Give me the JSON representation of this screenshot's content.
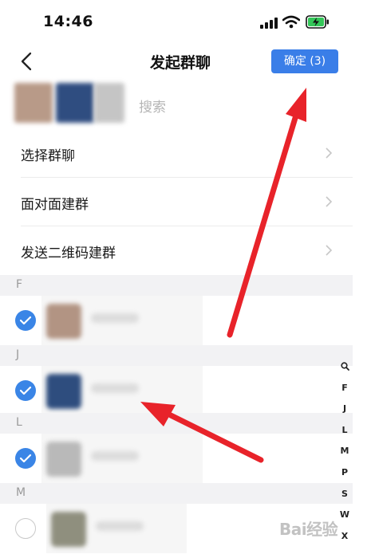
{
  "status_bar": {
    "time": "14:46"
  },
  "nav": {
    "title": "发起群聊",
    "confirm_label": "确定 (3)"
  },
  "search": {
    "placeholder": "搜索"
  },
  "menu": [
    {
      "label": "选择群聊"
    },
    {
      "label": "面对面建群"
    },
    {
      "label": "发送二维码建群"
    }
  ],
  "sections": [
    {
      "letter": "F",
      "contacts": [
        {
          "checked": true
        }
      ]
    },
    {
      "letter": "J",
      "contacts": [
        {
          "checked": true
        }
      ]
    },
    {
      "letter": "L",
      "contacts": [
        {
          "checked": true
        }
      ]
    },
    {
      "letter": "M",
      "contacts": [
        {
          "checked": false
        }
      ]
    }
  ],
  "index_bar": [
    "F",
    "J",
    "L",
    "M",
    "P",
    "S",
    "W",
    "X"
  ],
  "watermark": "Bai经验",
  "colors": {
    "accent": "#3a7ee8",
    "arrow": "#e8232a",
    "section_bg": "#f2f2f4"
  }
}
